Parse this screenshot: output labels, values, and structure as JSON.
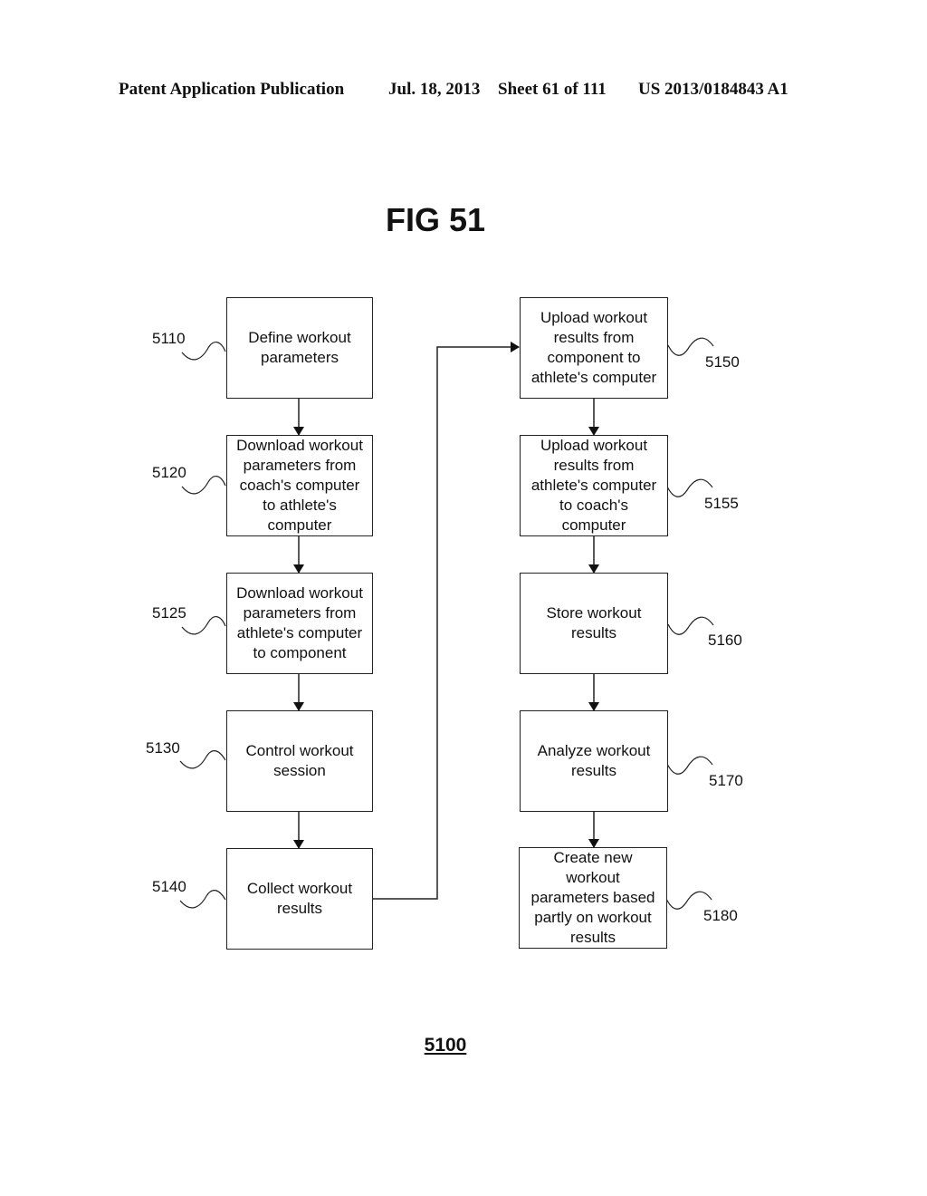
{
  "header": {
    "left": "Patent Application Publication",
    "date": "Jul. 18, 2013",
    "sheet": "Sheet 61 of 111",
    "pub_number": "US 2013/0184843 A1"
  },
  "figure": {
    "title": "FIG 51",
    "number": "5100"
  },
  "steps": [
    {
      "id": "5110",
      "text": "Define workout\nparameters"
    },
    {
      "id": "5120",
      "text": "Download workout\nparameters from\ncoach's computer\nto athlete's\ncomputer"
    },
    {
      "id": "5125",
      "text": "Download workout\nparameters from\nathlete's computer\nto component"
    },
    {
      "id": "5130",
      "text": "Control workout\nsession"
    },
    {
      "id": "5140",
      "text": "Collect workout\nresults"
    },
    {
      "id": "5150",
      "text": "Upload workout\nresults from\ncomponent to\nathlete's computer"
    },
    {
      "id": "5155",
      "text": "Upload workout\nresults from\nathlete's computer\nto coach's\ncomputer"
    },
    {
      "id": "5160",
      "text": "Store workout\nresults"
    },
    {
      "id": "5170",
      "text": "Analyze workout\nresults"
    },
    {
      "id": "5180",
      "text": "Create new\nworkout\nparameters based\npartly on workout\nresults"
    }
  ],
  "flow": [
    [
      "5110",
      "5120"
    ],
    [
      "5120",
      "5125"
    ],
    [
      "5125",
      "5130"
    ],
    [
      "5130",
      "5140"
    ],
    [
      "5140",
      "5150"
    ],
    [
      "5150",
      "5155"
    ],
    [
      "5155",
      "5160"
    ],
    [
      "5160",
      "5170"
    ],
    [
      "5170",
      "5180"
    ]
  ]
}
